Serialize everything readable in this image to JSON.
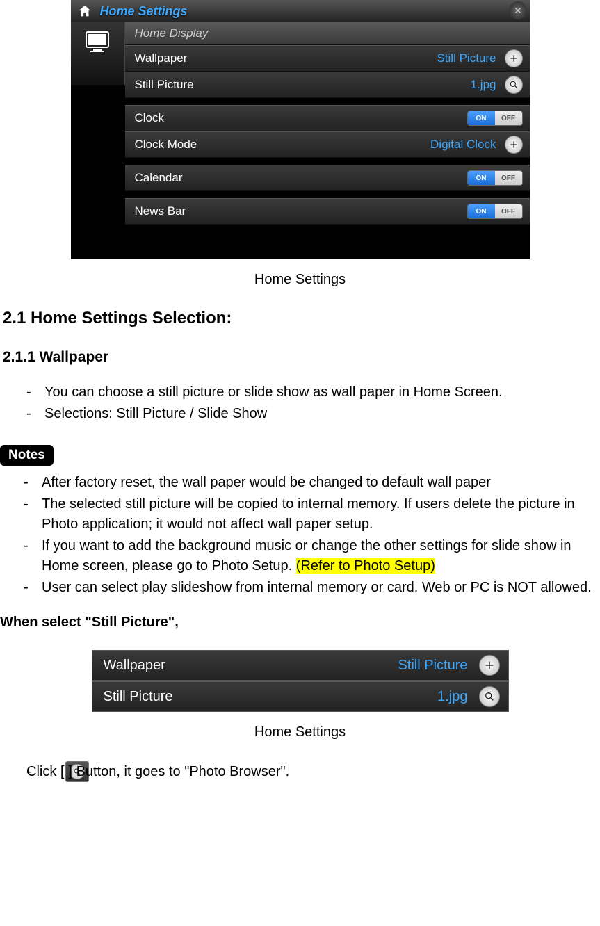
{
  "screenshot1": {
    "title": "Home Settings",
    "section_header": "Home Display",
    "rows": {
      "wallpaper": {
        "label": "Wallpaper",
        "value": "Still Picture"
      },
      "still_picture": {
        "label": "Still Picture",
        "value": "1.jpg"
      },
      "clock": {
        "label": "Clock",
        "on": "ON",
        "off": "OFF"
      },
      "clock_mode": {
        "label": "Clock Mode",
        "value": "Digital Clock"
      },
      "calendar": {
        "label": "Calendar",
        "on": "ON",
        "off": "OFF"
      },
      "news_bar": {
        "label": "News Bar",
        "on": "ON",
        "off": "OFF"
      }
    }
  },
  "caption1": "Home Settings",
  "heading21": "2.1 Home Settings Selection:",
  "heading211": "2.1.1 Wallpaper",
  "bullets1": [
    "You can choose a still picture or slide show as wall paper in Home Screen.",
    "Selections: Still Picture / Slide Show"
  ],
  "notes_label": "Notes",
  "notes_bullets": [
    "After factory reset, the wall paper would be changed to default wall paper",
    "The selected still picture will be copied to internal memory. If users delete the picture in Photo application; it would not affect wall paper setup.",
    {
      "pre": "If you want to add the background music or change the other settings for slide show in Home screen, please go to Photo Setup. ",
      "hl": "(Refer to Photo Setup)"
    },
    "User can select play slideshow from internal memory or card. Web or PC is NOT allowed."
  ],
  "when_select": "When select \"Still Picture\",",
  "screenshot2": {
    "wallpaper": {
      "label": "Wallpaper",
      "value": "Still Picture"
    },
    "still_picture": {
      "label": "Still Picture",
      "value": "1.jpg"
    }
  },
  "caption2": "Home Settings",
  "final_line": {
    "pre": "Click [",
    "post": "] Button, it goes to \"Photo Browser\"."
  }
}
